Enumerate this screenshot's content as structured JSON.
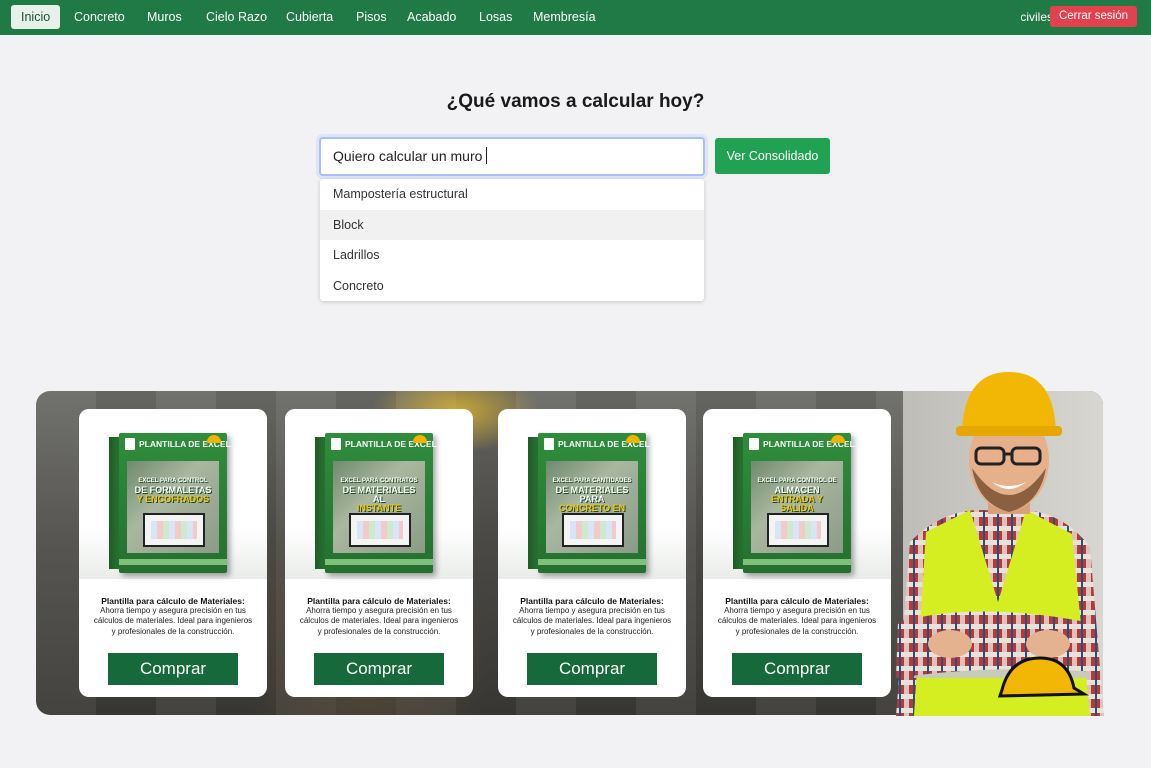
{
  "nav": {
    "items": [
      {
        "label": "Inicio",
        "active": true
      },
      {
        "label": "Concreto",
        "active": false
      },
      {
        "label": "Muros",
        "active": false
      },
      {
        "label": "Cielo Razo",
        "active": false
      },
      {
        "label": "Cubierta",
        "active": false
      },
      {
        "label": "Pisos",
        "active": false
      },
      {
        "label": "Acabado",
        "active": false
      },
      {
        "label": "Losas",
        "active": false
      },
      {
        "label": "Membresía",
        "active": false
      }
    ],
    "user": "civiles",
    "logout_label": "Cerrar sesión"
  },
  "main": {
    "headline": "¿Qué vamos a calcular hoy?",
    "search_value": "Quiero calcular un muro",
    "consolidado_label": "Ver Consolidado",
    "suggestions": [
      "Mampostería estructural",
      "Block",
      "Ladrillos",
      "Concreto"
    ]
  },
  "banner": {
    "cards": [
      {
        "box_title": "PLANTILLA DE EXCEL",
        "box_line1": "EXCEL PARA CONTROL",
        "box_line2": "DE FORMALETAS",
        "box_line3": "Y ENCOFRADOS",
        "title": "Plantilla para cálculo de Materiales:",
        "desc": "Ahorra tiempo y asegura precisión en tus cálculos de materiales. Ideal para ingenieros y profesionales de la construcción.",
        "button": "Comprar"
      },
      {
        "box_title": "PLANTILLA DE EXCEL",
        "box_line1": "EXCEL PARA CONTRATOS",
        "box_line2": "DE MATERIALES AL",
        "box_line3": "INSTANTE",
        "title": "Plantilla para cálculo de Materiales:",
        "desc": "Ahorra tiempo y asegura precisión en tus cálculos de materiales. Ideal para ingenieros y profesionales de la construcción.",
        "button": "Comprar"
      },
      {
        "box_title": "PLANTILLA DE EXCEL",
        "box_line1": "EXCEL PARA CANTIDADES",
        "box_line2": "DE MATERIALES PARA",
        "box_line3": "CONCRETO EN OBRA",
        "title": "Plantilla para cálculo de Materiales:",
        "desc": "Ahorra tiempo y asegura precisión en tus cálculos de materiales. Ideal para ingenieros y profesionales de la construcción.",
        "button": "Comprar"
      },
      {
        "box_title": "PLANTILLA DE EXCEL",
        "box_line1": "EXCEL PARA CONTROL DE",
        "box_line2": "ALMACEN",
        "box_line3": "ENTRADA Y SALIDA",
        "title": "Plantilla para cálculo de Materiales:",
        "desc": "Ahorra tiempo y asegura precisión en tus cálculos de materiales. Ideal para ingenieros y profesionales de la construcción.",
        "button": "Comprar"
      }
    ]
  },
  "colors": {
    "navbar": "#1f7a45",
    "logout": "#e4414f",
    "consolidado": "#21a152",
    "buy": "#15693a"
  }
}
